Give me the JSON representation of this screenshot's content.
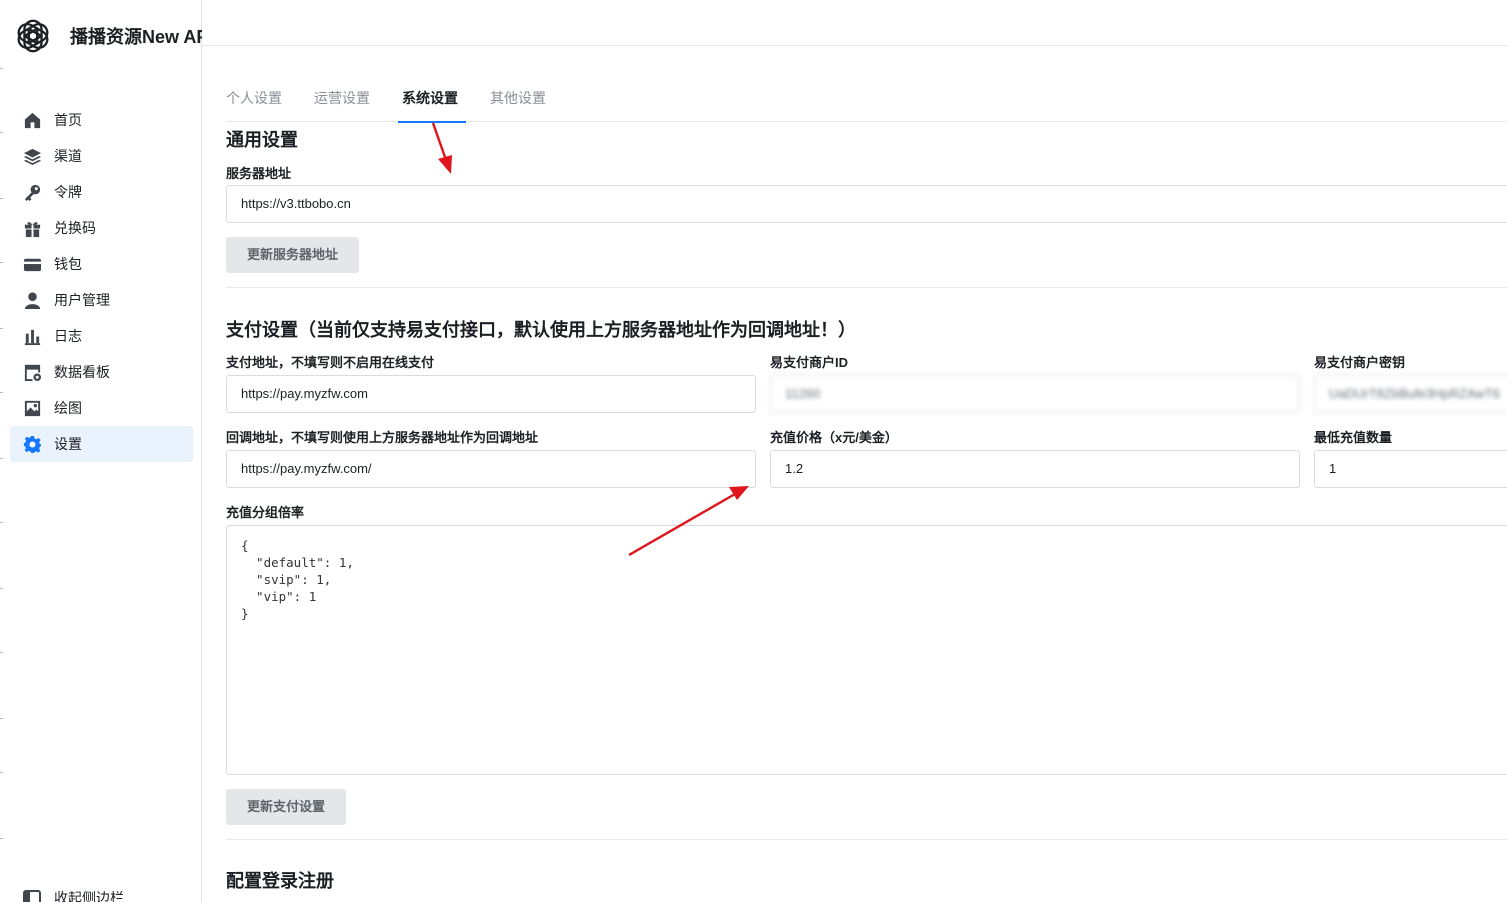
{
  "brand": {
    "name": "播播资源New API"
  },
  "sidebar": {
    "items": [
      {
        "label": "首页",
        "icon": "home-icon"
      },
      {
        "label": "渠道",
        "icon": "layers-icon"
      },
      {
        "label": "令牌",
        "icon": "key-icon"
      },
      {
        "label": "兑换码",
        "icon": "gift-icon"
      },
      {
        "label": "钱包",
        "icon": "credit-card-icon"
      },
      {
        "label": "用户管理",
        "icon": "user-icon"
      },
      {
        "label": "日志",
        "icon": "bar-chart-icon"
      },
      {
        "label": "数据看板",
        "icon": "dashboard-icon"
      },
      {
        "label": "绘图",
        "icon": "image-icon"
      },
      {
        "label": "设置",
        "icon": "gear-icon"
      }
    ],
    "active_index": 9,
    "collapse_label": "收起侧边栏"
  },
  "tabs": [
    "个人设置",
    "运营设置",
    "系统设置",
    "其他设置"
  ],
  "active_tab": "系统设置",
  "general": {
    "title": "通用设置",
    "server_label": "服务器地址",
    "server_value": "https://v3.ttbobo.cn",
    "update_button": "更新服务器地址"
  },
  "payment": {
    "title": "支付设置（当前仅支持易支付接口，默认使用上方服务器地址作为回调地址！）",
    "pay_address_label": "支付地址，不填写则不启用在线支付",
    "pay_address_value": "https://pay.myzfw.com",
    "merchant_id_label": "易支付商户ID",
    "merchant_id_value": "11260",
    "merchant_key_label": "易支付商户密钥",
    "merchant_key_value": "UaDUrT8ZbBufe3HpRZAwT6",
    "callback_label": "回调地址，不填写则使用上方服务器地址作为回调地址",
    "callback_value": "https://pay.myzfw.com/",
    "price_label": "充值价格（x元/美金）",
    "price_value": "1.2",
    "min_topup_label": "最低充值数量",
    "min_topup_value": "1",
    "group_ratio_label": "充值分组倍率",
    "group_ratio_value": "{\n  \"default\": 1,\n  \"svip\": 1,\n  \"vip\": 1\n}",
    "update_button": "更新支付设置"
  },
  "login": {
    "title": "配置登录注册"
  },
  "colors": {
    "accent": "#1677ff",
    "annotation_arrow": "#e0151b",
    "active_nav_bg": "#eaf2fd"
  }
}
